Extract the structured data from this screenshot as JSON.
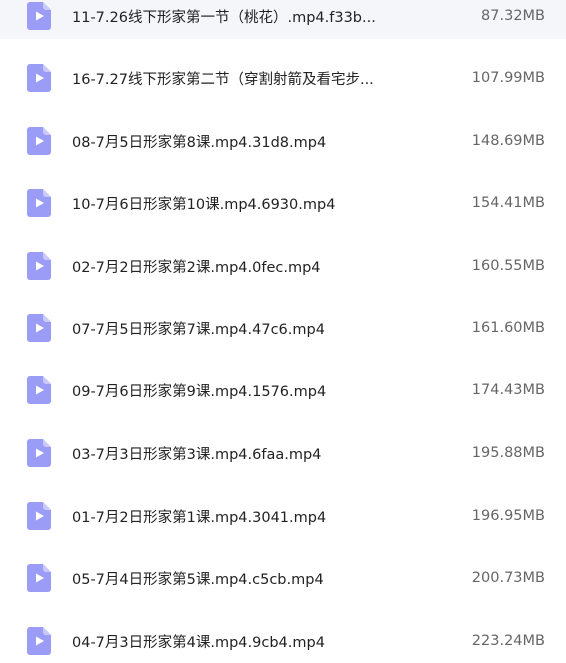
{
  "files": [
    {
      "name": "11-7.26线下形家第一节（桃花）.mp4.f33b...",
      "size": "87.32MB",
      "icon": "video-file-icon"
    },
    {
      "name": "16-7.27线下形家第二节（穿割射箭及看宅步...",
      "size": "107.99MB",
      "icon": "video-file-icon"
    },
    {
      "name": "08-7月5日形家第8课.mp4.31d8.mp4",
      "size": "148.69MB",
      "icon": "video-file-icon"
    },
    {
      "name": "10-7月6日形家第10课.mp4.6930.mp4",
      "size": "154.41MB",
      "icon": "video-file-icon"
    },
    {
      "name": "02-7月2日形家第2课.mp4.0fec.mp4",
      "size": "160.55MB",
      "icon": "video-file-icon"
    },
    {
      "name": "07-7月5日形家第7课.mp4.47c6.mp4",
      "size": "161.60MB",
      "icon": "video-file-icon"
    },
    {
      "name": "09-7月6日形家第9课.mp4.1576.mp4",
      "size": "174.43MB",
      "icon": "video-file-icon"
    },
    {
      "name": "03-7月3日形家第3课.mp4.6faa.mp4",
      "size": "195.88MB",
      "icon": "video-file-icon"
    },
    {
      "name": "01-7月2日形家第1课.mp4.3041.mp4",
      "size": "196.95MB",
      "icon": "video-file-icon"
    },
    {
      "name": "05-7月4日形家第5课.mp4.c5cb.mp4",
      "size": "200.73MB",
      "icon": "video-file-icon"
    },
    {
      "name": "04-7月3日形家第4课.mp4.9cb4.mp4",
      "size": "223.24MB",
      "icon": "video-file-icon"
    }
  ],
  "colors": {
    "icon_body": "#9b9cf6",
    "icon_fold": "#c9caf9",
    "icon_play": "#ffffff"
  }
}
